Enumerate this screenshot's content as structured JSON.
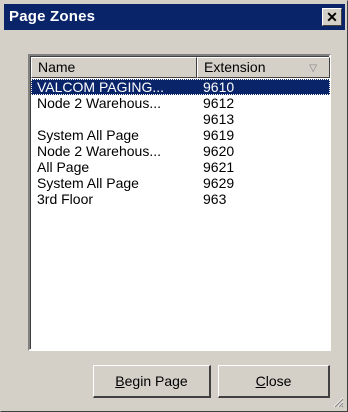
{
  "window": {
    "title": "Page Zones",
    "close_glyph": "✕"
  },
  "list": {
    "columns": [
      {
        "label": "Name"
      },
      {
        "label": "Extension"
      }
    ],
    "sort_icon": "sort-descending-icon",
    "rows": [
      {
        "name": "VALCOM PAGING...",
        "extension": "9610",
        "selected": true
      },
      {
        "name": "Node 2 Warehous...",
        "extension": "9612"
      },
      {
        "name": "",
        "extension": "9613"
      },
      {
        "name": "System All Page",
        "extension": "9619"
      },
      {
        "name": "Node 2 Warehous...",
        "extension": "9620"
      },
      {
        "name": "All Page",
        "extension": "9621"
      },
      {
        "name": "System All Page",
        "extension": "9629"
      },
      {
        "name": "3rd Floor",
        "extension": "963"
      }
    ]
  },
  "buttons": {
    "begin_page": {
      "accel": "B",
      "rest": "egin Page"
    },
    "close": {
      "accel": "C",
      "rest": "lose"
    }
  },
  "colors": {
    "face": "#d4d0c8",
    "title_bar": "#0a246a",
    "selection": "#0a246a"
  }
}
